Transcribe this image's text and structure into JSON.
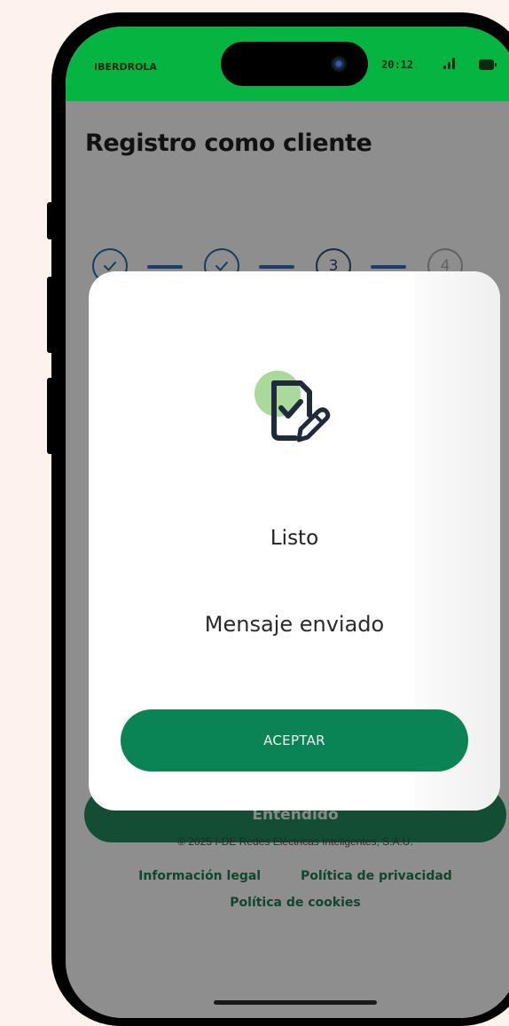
{
  "status_bar": {
    "carrier": "IBERDROLA",
    "time": "20:12",
    "signal_icon": "signal-icon",
    "battery_icon": "battery-icon"
  },
  "page": {
    "title": "Registro como cliente",
    "steps": [
      {
        "label": "",
        "state": "done",
        "icon": "check-icon"
      },
      {
        "label": "",
        "state": "done",
        "icon": "check-icon"
      },
      {
        "label": "3",
        "state": "current"
      },
      {
        "label": "4",
        "state": "todo"
      }
    ],
    "primary_button": "Entendido",
    "copyright": "© 2025 I-DE Redes Eléctricas Inteligentes, S.A.U.",
    "footer_links": [
      "Información legal",
      "Política de privacidad",
      "Política de cookies"
    ]
  },
  "modal": {
    "icon": "document-check-edit-icon",
    "title": "Listo",
    "message": "Mensaje enviado",
    "accept_label": "ACEPTAR"
  },
  "colors": {
    "status_green": "#06b541",
    "accept_button": "#0a8454",
    "stepper_blue": "#2f6db3",
    "link_green": "#1b7a50"
  }
}
